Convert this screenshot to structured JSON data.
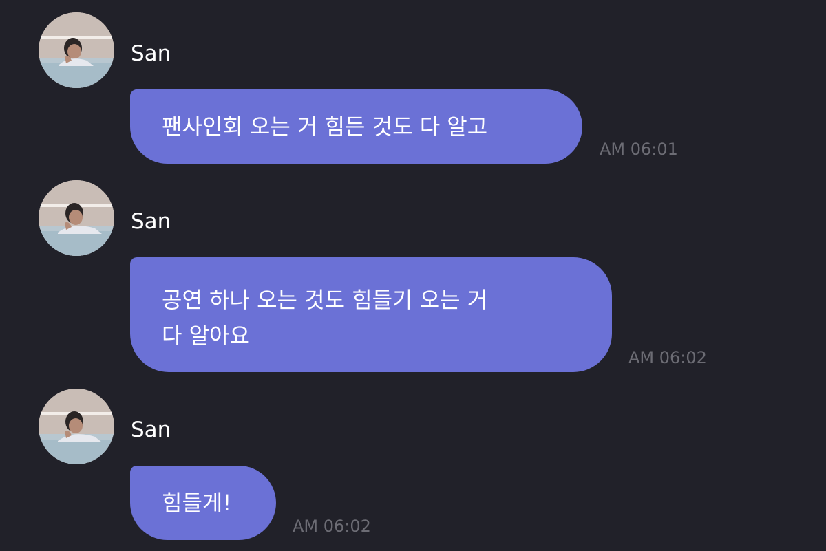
{
  "messages": [
    {
      "sender": "San",
      "avatar": "profile-photo",
      "text": "팬사인회 오는 거 힘든 것도 다 알고",
      "time": "AM 06:01"
    },
    {
      "sender": "San",
      "avatar": "profile-photo",
      "text": "공연 하나 오는 것도 힘들기 오는 거\n다 알아요",
      "time": "AM 06:02"
    },
    {
      "sender": "San",
      "avatar": "profile-photo",
      "text": "힘들게!",
      "time": "AM 06:02"
    }
  ],
  "colors": {
    "background": "#212129",
    "bubble": "#6b71d6",
    "timestamp": "#6c6c74",
    "sender_name": "#ffffff"
  }
}
